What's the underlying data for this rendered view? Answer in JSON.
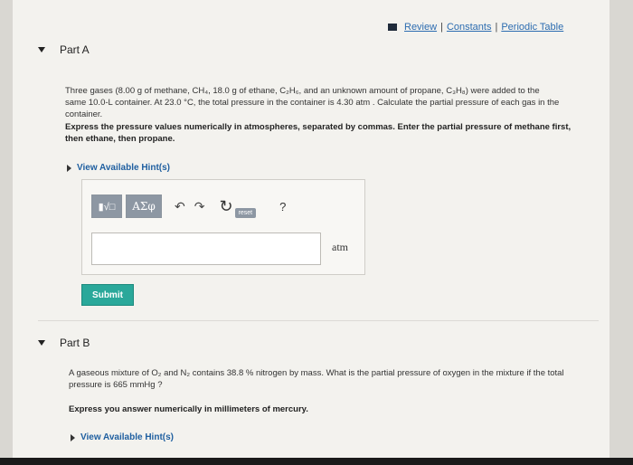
{
  "top_links": {
    "review": "Review",
    "constants": "Constants",
    "periodic_table": "Periodic Table",
    "separator": "|"
  },
  "part_a": {
    "label": "Part A",
    "question": "Three gases (8.00 g of methane, CH₄, 18.0 g of ethane, C₂H₆, and an unknown amount of propane, C₃H₈) were added to the same 10.0-L container. At 23.0 °C, the total pressure in the container is 4.30 atm . Calculate the partial pressure of each gas in the container.",
    "instruction": "Express the pressure values numerically in atmospheres, separated by commas. Enter the partial pressure of methane first, then ethane, then propane.",
    "hint_link": "View Available Hint(s)",
    "toolbar": {
      "template_icon": "template-icon",
      "symbols_label": "ΑΣφ",
      "undo_icon": "undo-icon",
      "redo_icon": "redo-icon",
      "reset_icon": "reset-icon",
      "reset_label": "reset",
      "help_label": "?"
    },
    "input_value": "",
    "unit": "atm",
    "submit_label": "Submit"
  },
  "part_b": {
    "label": "Part B",
    "question": "A gaseous mixture of O₂ and N₂ contains 38.8 % nitrogen by mass. What is the partial pressure of oxygen in the mixture if the total pressure is 665 mmHg ?",
    "instruction": "Express you answer numerically in millimeters of mercury.",
    "hint_link": "View Available Hint(s)"
  },
  "colors": {
    "link": "#2c6cb0",
    "submit_bg": "#2aa89a",
    "toolbar_button": "#8d97a3"
  }
}
